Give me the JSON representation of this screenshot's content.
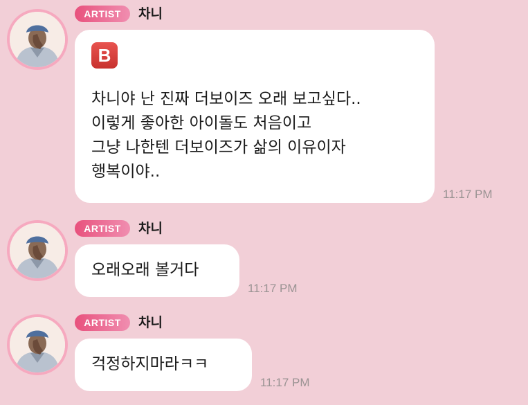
{
  "colors": {
    "background": "#f2cfd7",
    "badge_gradient_start": "#e8517d",
    "badge_gradient_end": "#f08eb0",
    "bubble": "#ffffff",
    "timestamp": "#9a9393",
    "b_icon": "#d9413d"
  },
  "messages": [
    {
      "badge": "ARTIST",
      "sender": "차니",
      "avatar_icon": "artist-avatar",
      "emoji": "B",
      "emoji_icon": "b-button-emoji-icon",
      "lines": [
        "차니야 난 진짜 더보이즈 오래 보고싶다..",
        "이렇게 좋아한 아이돌도 처음이고",
        "그냥 나한텐 더보이즈가 삶의 이유이자",
        "행복이야.."
      ],
      "time": "11:17 PM"
    },
    {
      "badge": "ARTIST",
      "sender": "차니",
      "avatar_icon": "artist-avatar",
      "lines": [
        "오래오래 볼거다"
      ],
      "time": "11:17 PM"
    },
    {
      "badge": "ARTIST",
      "sender": "차니",
      "avatar_icon": "artist-avatar",
      "lines": [
        "걱정하지마라ㅋㅋ"
      ],
      "time": "11:17 PM"
    }
  ]
}
